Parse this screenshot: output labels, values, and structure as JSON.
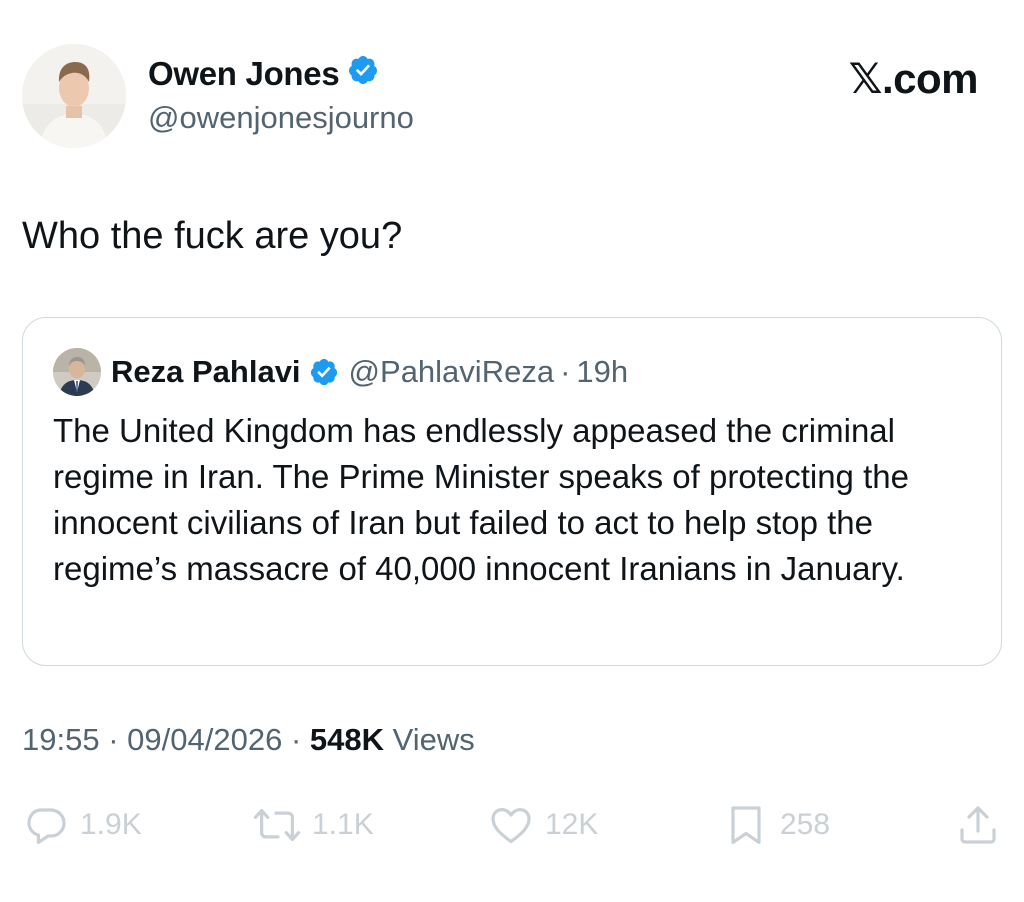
{
  "author": {
    "name": "Owen Jones",
    "handle": "@owenjonesjourno",
    "verified": true
  },
  "site": "𝕏.com",
  "tweet": {
    "text": "Who the fuck are you?"
  },
  "quoted_tweet": {
    "name": "Reza Pahlavi",
    "verified": true,
    "handle": "@PahlaviReza",
    "separator": "·",
    "time": "19h",
    "text": "The United Kingdom has endlessly appeased the criminal regime in Iran. The Prime Minister speaks of protecting the innocent civilians of Iran but failed to act to help stop the regime’s massacre of 40,000 innocent Iranians in January."
  },
  "meta": {
    "time": "19:55",
    "separator": "·",
    "date": "09/04/2026",
    "views_count": "548K",
    "views_label": "Views"
  },
  "actions": {
    "replies": "1.9K",
    "reposts": "1.1K",
    "likes": "12K",
    "bookmarks": "258"
  },
  "colors": {
    "verified": "#1d9bf0",
    "secondary_text": "#536471",
    "action_icons": "#c9d1d7",
    "border": "#cfd9de"
  }
}
